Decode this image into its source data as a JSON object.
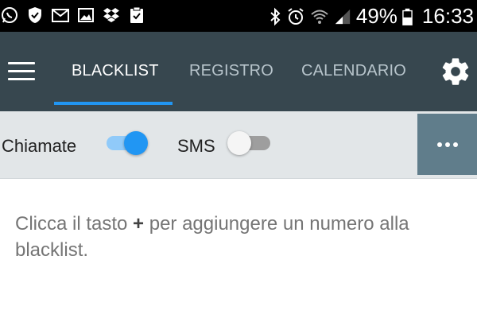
{
  "status_bar": {
    "battery": "49%",
    "time": "16:33",
    "left_icons": [
      "whatsapp-icon",
      "shield-icon",
      "gmail-icon",
      "gallery-icon",
      "dropbox-icon",
      "clipboard-check-icon"
    ],
    "right_icons": [
      "bluetooth-icon",
      "alarm-icon",
      "wifi-icon",
      "signal-icon",
      "battery-icon"
    ]
  },
  "appbar": {
    "tabs": [
      {
        "label": "BLACKLIST",
        "active": true
      },
      {
        "label": "REGISTRO",
        "active": false
      },
      {
        "label": "CALENDARIO",
        "active": false
      }
    ],
    "accent": "#2196f3",
    "background": "#37474f"
  },
  "toolbar": {
    "calls_label": "Chiamate",
    "calls_enabled": true,
    "sms_label": "SMS",
    "sms_enabled": false
  },
  "empty_state": {
    "part1": "Clicca il tasto ",
    "plus": "+",
    "part2": " per aggiungere un numero alla blacklist."
  }
}
